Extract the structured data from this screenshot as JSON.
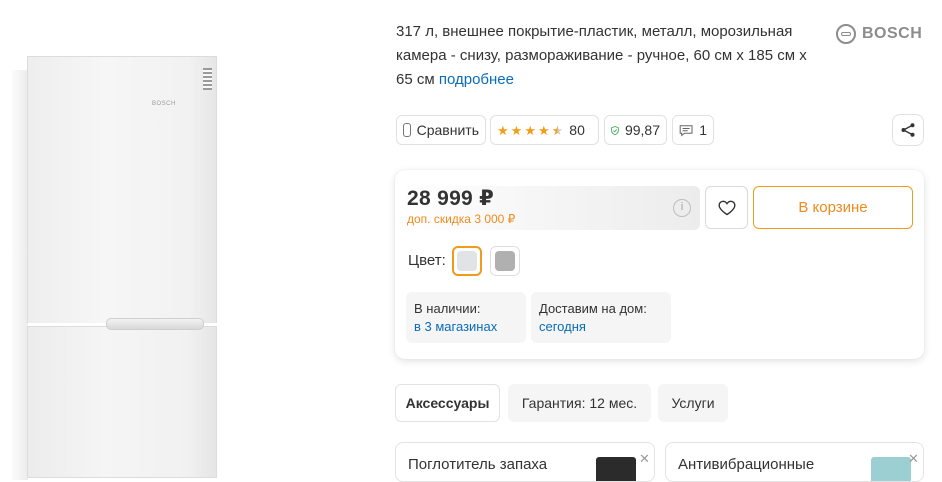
{
  "product_image": {
    "brand_mark": "BOSCH"
  },
  "description": {
    "text": "317 л, внешнее покрытие-пластик, металл, морозильная камера - снизу, размораживание - ручное, 60 см x 185 см x 65 см",
    "more_link": "подробнее"
  },
  "brand": {
    "name": "BOSCH"
  },
  "actions": {
    "compare_label": "Сравнить",
    "rating_stars": 4.5,
    "rating_count": "80",
    "reliability": "99,87",
    "comments_count": "1"
  },
  "price_card": {
    "price": "28 999 ₽",
    "discount": "доп. скидка 3 000 ₽",
    "cart_label": "В корзине",
    "color_label": "Цвет:",
    "swatches": [
      {
        "color": "#e2e3e6",
        "selected": true
      },
      {
        "color": "#b1b0b0",
        "selected": false
      }
    ],
    "availability": {
      "in_stock_label": "В наличии:",
      "in_stock_value": "в 3 магазинах",
      "delivery_label": "Доставим на дом:",
      "delivery_value": "сегодня"
    }
  },
  "tabs": [
    {
      "label": "Аксессуары",
      "active": true
    },
    {
      "label": "Гарантия: 12 мес.",
      "active": false
    },
    {
      "label": "Услуги",
      "active": false
    }
  ],
  "accessories": [
    {
      "title": "Поглотитель запаха"
    },
    {
      "title": "Антивибрационные"
    }
  ],
  "colors": {
    "accent": "#f09a1e",
    "link": "#0a6cb8",
    "star": "#f19d17"
  }
}
